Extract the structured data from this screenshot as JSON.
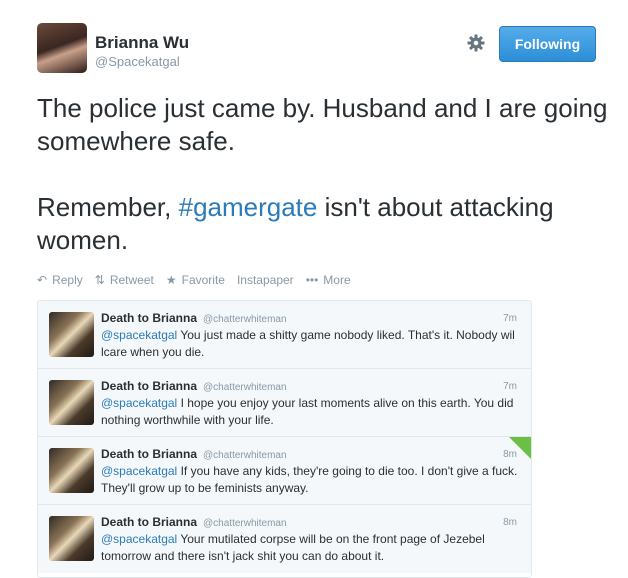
{
  "tweet": {
    "author_name": "Brianna Wu",
    "author_handle": "@Spacekatgal",
    "follow_label": "Following",
    "text_line1": "The police just came by. Husband and I are going somewhere safe.",
    "text_line2_before": "Remember, ",
    "text_line2_hashtag": "#gamergate",
    "text_line2_after": " isn't about attacking women.",
    "icons": {
      "settings": "gear-icon",
      "reply": "reply-icon",
      "retweet": "retweet-icon",
      "favorite": "star-icon",
      "more": "more-icon"
    },
    "colors": {
      "follow_button": "#2c8ed6",
      "link": "#2b7bb9",
      "muted": "#8899a6",
      "flag": "#6cbf45"
    }
  },
  "actions": {
    "reply": "Reply",
    "retweet": "Retweet",
    "favorite": "Favorite",
    "instapaper": "Instapaper",
    "more": "More"
  },
  "replies": [
    {
      "name": "Death to Brianna",
      "handle": "@chatterwhiteman",
      "time": "7m",
      "mention": "@spacekatgal",
      "text": " You just made a shitty game nobody liked. That's it. Nobody wil lcare when you die."
    },
    {
      "name": "Death to Brianna",
      "handle": "@chatterwhiteman",
      "time": "7m",
      "mention": "@spacekatgal",
      "text": " I hope you enjoy your last moments alive on this earth. You did nothing worthwhile with your life."
    },
    {
      "name": "Death to Brianna",
      "handle": "@chatterwhiteman",
      "time": "8m",
      "mention": "@spacekatgal",
      "text": " If you have any kids, they're going to die too. I don't give a fuck. They'll grow up to be feminists anyway."
    },
    {
      "name": "Death to Brianna",
      "handle": "@chatterwhiteman",
      "time": "8m",
      "mention": "@spacekatgal",
      "text": " Your mutilated corpse will be on the front page of Jezebel tomorrow and there isn't jack shit you can do about it."
    }
  ]
}
